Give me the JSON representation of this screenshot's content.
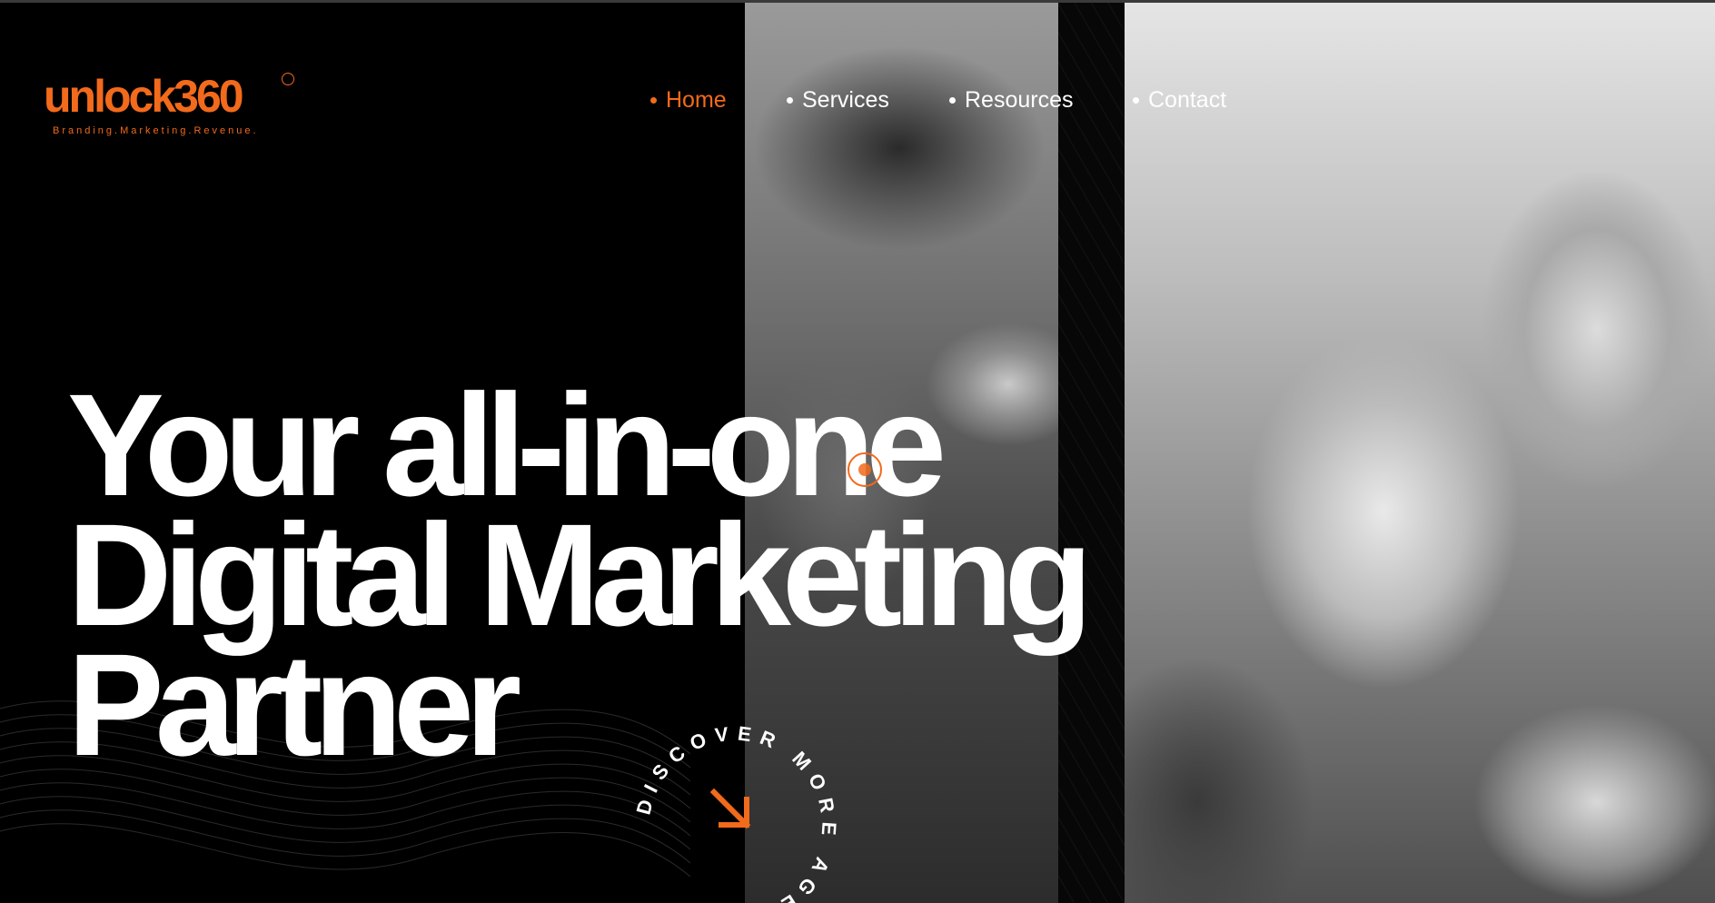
{
  "brand": {
    "name": "unlock360",
    "tagline": "Branding.Marketing.Revenue."
  },
  "nav": {
    "items": [
      {
        "label": "Home",
        "active": true
      },
      {
        "label": "Services",
        "active": false
      },
      {
        "label": "Resources",
        "active": false
      },
      {
        "label": "Contact",
        "active": false
      }
    ]
  },
  "hero": {
    "lines": [
      "Your all-in-one",
      "Digital Marketing",
      "Partner"
    ]
  },
  "badge": {
    "circle_text": "DISCOVER MORE AGENCY",
    "icon": "arrow-down-right-icon"
  },
  "colors": {
    "accent": "#f26a1b",
    "background": "#000000",
    "text": "#ffffff"
  }
}
